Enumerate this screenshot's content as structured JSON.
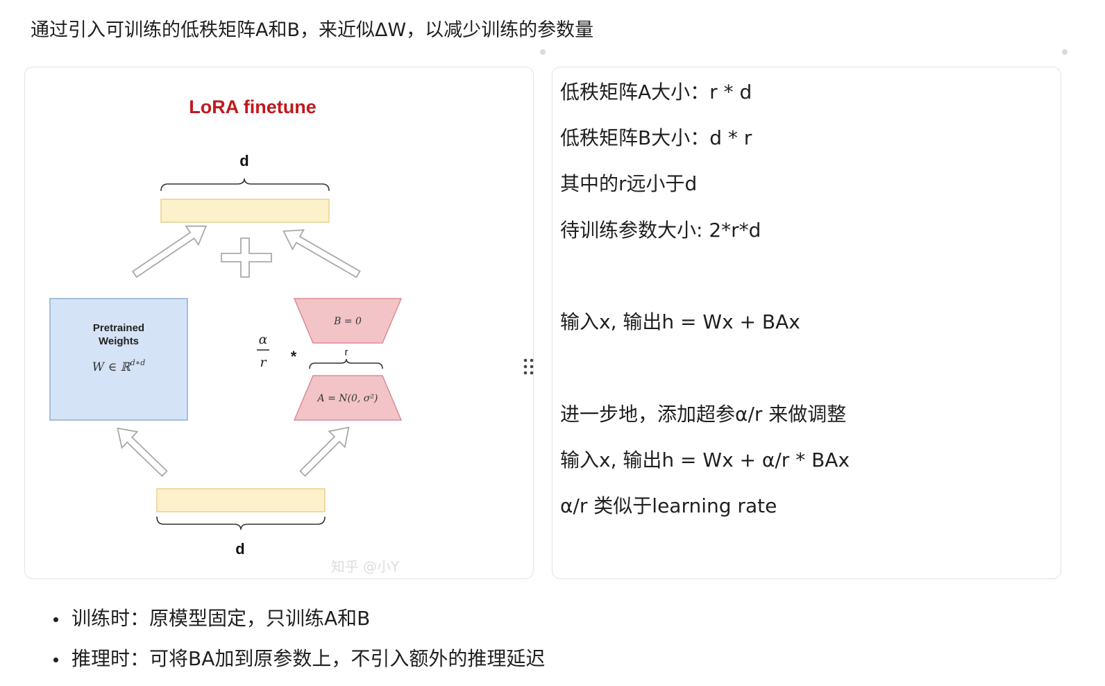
{
  "intro": "通过引入可训练的低秩矩阵A和B，来近似ΔW，以减少训练的参数量",
  "diagram": {
    "title": "LoRA finetune",
    "top_dim_label": "d",
    "bottom_dim_label": "d",
    "pretrained_line1": "Pretrained",
    "pretrained_line2": "Weights",
    "pretrained_formula": "W ∈ ℝ",
    "pretrained_formula_sup": "d∗d",
    "matrix_b": "B = 0",
    "matrix_a": "A = N(0, σ²)",
    "rank_label": "r",
    "alpha": "α",
    "r_den": "r",
    "multiply": "*",
    "watermark": "知乎 @小Y",
    "colors": {
      "title": "#c0191e",
      "vector_fill": "#fdf1cc",
      "vector_stroke": "#e8d08c",
      "pretrained_fill": "#d4e3f6",
      "pretrained_stroke": "#8eaed6",
      "lora_fill": "#f2c4c7",
      "lora_stroke": "#d98b91"
    }
  },
  "right_panel": {
    "lines": [
      "低秩矩阵A大小：r * d",
      "低秩矩阵B大小：d * r",
      "其中的r远小于d",
      "待训练参数大小: 2*r*d",
      "输入x, 输出h = Wx + BAx",
      "进一步地，添加超参α/r 来做调整",
      "输入x, 输出h = Wx + α/r * BAx",
      "α/r 类似于learning rate"
    ]
  },
  "bullets": [
    "训练时：原模型固定，只训练A和B",
    "推理时：可将BA加到原参数上，不引入额外的推理延迟"
  ]
}
